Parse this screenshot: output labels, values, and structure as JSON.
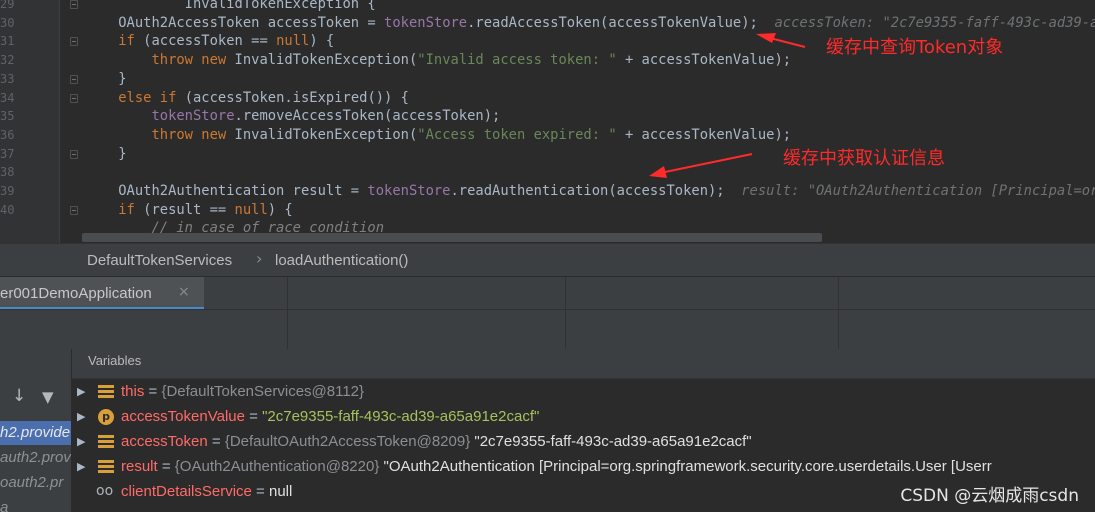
{
  "editor": {
    "line_numbers": [
      "29",
      "30",
      "31",
      "32",
      "33",
      "34",
      "35",
      "36",
      "37",
      "38",
      "39",
      "40"
    ],
    "lines": [
      [
        {
          "t": "            InvalidTokenException {",
          "c": ""
        }
      ],
      [
        {
          "t": "    OAuth2AccessToken accessToken = ",
          "c": ""
        },
        {
          "t": "tokenStore",
          "c": "fld"
        },
        {
          "t": ".readAccessToken(accessTokenValue);",
          "c": ""
        },
        {
          "t": "  accessToken: \"2c7e9355-faff-493c-ad39-a6",
          "c": "hint"
        }
      ],
      [
        {
          "t": "    ",
          "c": ""
        },
        {
          "t": "if",
          "c": "kw"
        },
        {
          "t": " (accessToken == ",
          "c": ""
        },
        {
          "t": "null",
          "c": "kw"
        },
        {
          "t": ") {",
          "c": ""
        }
      ],
      [
        {
          "t": "        ",
          "c": ""
        },
        {
          "t": "throw new",
          "c": "kw"
        },
        {
          "t": " InvalidTokenException(",
          "c": ""
        },
        {
          "t": "\"Invalid access token: \"",
          "c": "str"
        },
        {
          "t": " + accessTokenValue);",
          "c": ""
        }
      ],
      [
        {
          "t": "    }",
          "c": ""
        }
      ],
      [
        {
          "t": "    ",
          "c": ""
        },
        {
          "t": "else if",
          "c": "kw"
        },
        {
          "t": " (accessToken.isExpired()) {",
          "c": ""
        }
      ],
      [
        {
          "t": "        ",
          "c": ""
        },
        {
          "t": "tokenStore",
          "c": "fld"
        },
        {
          "t": ".removeAccessToken(accessToken);",
          "c": ""
        }
      ],
      [
        {
          "t": "        ",
          "c": ""
        },
        {
          "t": "throw new",
          "c": "kw"
        },
        {
          "t": " InvalidTokenException(",
          "c": ""
        },
        {
          "t": "\"Access token expired: \"",
          "c": "str"
        },
        {
          "t": " + accessTokenValue);",
          "c": ""
        }
      ],
      [
        {
          "t": "    }",
          "c": ""
        }
      ],
      [
        {
          "t": "",
          "c": ""
        }
      ],
      [
        {
          "t": "    OAuth2Authentication result = ",
          "c": ""
        },
        {
          "t": "tokenStore",
          "c": "fld"
        },
        {
          "t": ".readAuthentication(accessToken);",
          "c": ""
        },
        {
          "t": "  result: \"OAuth2Authentication [Principal=org",
          "c": "hint"
        }
      ],
      [
        {
          "t": "    ",
          "c": ""
        },
        {
          "t": "if",
          "c": "kw"
        },
        {
          "t": " (result == ",
          "c": ""
        },
        {
          "t": "null",
          "c": "kw"
        },
        {
          "t": ") {",
          "c": ""
        }
      ],
      [
        {
          "t": "        // in case of race condition",
          "c": "cmt"
        }
      ]
    ],
    "annotation_1": "缓存中查询Token对象",
    "annotation_2": "缓存中获取认证信息"
  },
  "breadcrumb": {
    "class_name": "DefaultTokenServices",
    "separator": "›",
    "method_name": "loadAuthentication()"
  },
  "debug": {
    "run_tab_label": "er001DemoApplication",
    "close_glyph": "×",
    "frame_buttons": [
      "↓",
      "▼"
    ],
    "frames": [
      "h2.provide",
      "auth2.provi",
      "oauth2.pr",
      "a"
    ],
    "variables_title": "Variables",
    "variables": [
      {
        "name": "this",
        "eq": " = ",
        "type": "{DefaultTokenServices@8112}",
        "value": "",
        "icon": "field",
        "expandable": true
      },
      {
        "name": "accessTokenValue",
        "eq": " = ",
        "type": "",
        "value": "\"2c7e9355-faff-493c-ad39-a65a91e2cacf\"",
        "icon": "param",
        "expandable": true
      },
      {
        "name": "accessToken",
        "eq": " = ",
        "type": "{DefaultOAuth2AccessToken@8209}",
        "value": " \"2c7e9355-faff-493c-ad39-a65a91e2cacf\"",
        "icon": "field",
        "expandable": true
      },
      {
        "name": "result",
        "eq": " = ",
        "type": "{OAuth2Authentication@8220}",
        "value": " \"OAuth2Authentication [Principal=org.springframework.security.core.userdetails.User [Userr",
        "icon": "field",
        "expandable": true
      },
      {
        "name": "clientDetailsService",
        "eq": " = ",
        "type": "",
        "value": "null",
        "icon": "watch",
        "expandable": false
      }
    ]
  },
  "watermark": "CSDN @云烟成雨csdn",
  "colors": {
    "editor_bg": "#2b2b2b",
    "keyword": "#cc7832",
    "string": "#6a8759",
    "field": "#9876aa",
    "annotation": "#ff2a2a",
    "selected_frame": "#4b6eaf",
    "var_name": "#ff6b68"
  }
}
